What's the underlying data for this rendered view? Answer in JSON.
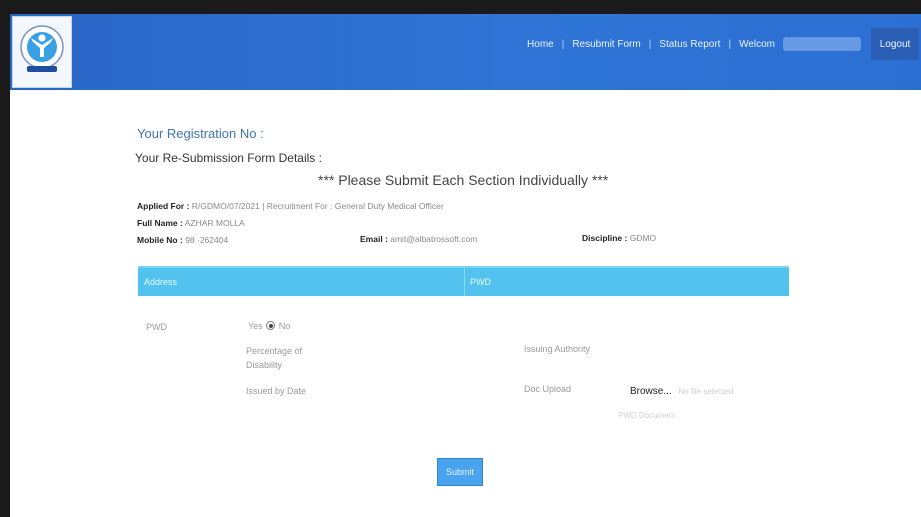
{
  "header": {
    "nav": {
      "home": "Home",
      "resubmit": "Resubmit Form",
      "status": "Status Report",
      "welcome": "Welcom"
    },
    "logout": "Logout",
    "logo_icon": "organization-logo-icon"
  },
  "page": {
    "registration_label": "Your Registration No :",
    "resubmission_label": "Your Re-Submission Form Details :",
    "notice": "*** Please Submit Each Section Individually ***"
  },
  "applicant": {
    "applied_for_label": "Applied For :",
    "applied_for_value": "R/GDMO/07/2021 | Recruitment For : General Duty Medical Officer",
    "full_name_label": "Full Name :",
    "full_name_value": "AZHAR MOLLA",
    "mobile_label": "Mobile No :",
    "mobile_value": "98 ·262404",
    "email_label": "Email :",
    "email_value": "amit@albatrossoft.com",
    "discipline_label": "Discipline :",
    "discipline_value": "GDMO"
  },
  "sections": {
    "address": "Address",
    "pwd": "PWD"
  },
  "pwd_form": {
    "pwd_label": "PWD",
    "yes_label": "Yes",
    "no_label": "No",
    "selected": "No",
    "percentage_label_1": "Percentage of",
    "percentage_label_2": "Disability",
    "issuing_authority_label": "Issuing Authority",
    "issued_date_label": "Issued by Date",
    "doc_upload_label": "Doc Upload",
    "browse_label": "Browse...",
    "no_file_label": "No file selected.",
    "pwd_document_label": "PWD Document"
  },
  "submit_label": "Submit"
}
